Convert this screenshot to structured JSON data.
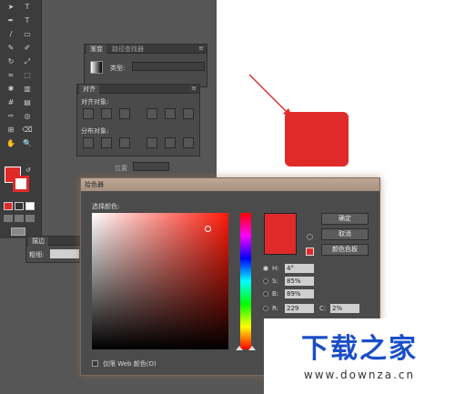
{
  "colors": {
    "accent": "#e02a2a",
    "arrow": "#e03030",
    "square": "#e02a2a",
    "watermark": "#1a4fc8"
  },
  "toolbar": {
    "icons": [
      "selection-tool-icon",
      "direct-select-icon",
      "pen-tool-icon",
      "type-tool-icon",
      "line-tool-icon",
      "rectangle-tool-icon",
      "brush-tool-icon",
      "pencil-tool-icon",
      "rotate-tool-icon",
      "scale-tool-icon",
      "warp-tool-icon",
      "free-transform-icon",
      "symbol-sprayer-icon",
      "column-graph-icon",
      "mesh-tool-icon",
      "gradient-tool-icon",
      "eyedropper-tool-icon",
      "blend-tool-icon",
      "slice-tool-icon",
      "eraser-tool-icon",
      "hand-tool-icon",
      "zoom-tool-icon"
    ]
  },
  "gradient_panel": {
    "tab_gradient": "渐变",
    "tab_pathfinder": "路径查找器",
    "type_label": "类型:"
  },
  "align_panel": {
    "tab_align": "对齐",
    "align_objects": "对齐对象:",
    "distribute_objects": "分布对象:",
    "position_label": "位置"
  },
  "stroke_panel": {
    "tab_stroke": "描边",
    "weight_label": "粗细:"
  },
  "color_picker": {
    "title": "拾色器",
    "select_color": "选择颜色:",
    "ok": "确定",
    "cancel": "取消",
    "swatches": "颜色色板",
    "h_label": "H:",
    "h_value": "4°",
    "s_label": "S:",
    "s_value": "85%",
    "b_label": "B:",
    "b_value": "89%",
    "r_label": "R:",
    "r_value": "229",
    "c_label": "C:",
    "c_value": "2%",
    "web_only": "仅限 Web 颜色(O)"
  },
  "watermark": {
    "title": "下载之家",
    "url": "www.downza.cn"
  }
}
